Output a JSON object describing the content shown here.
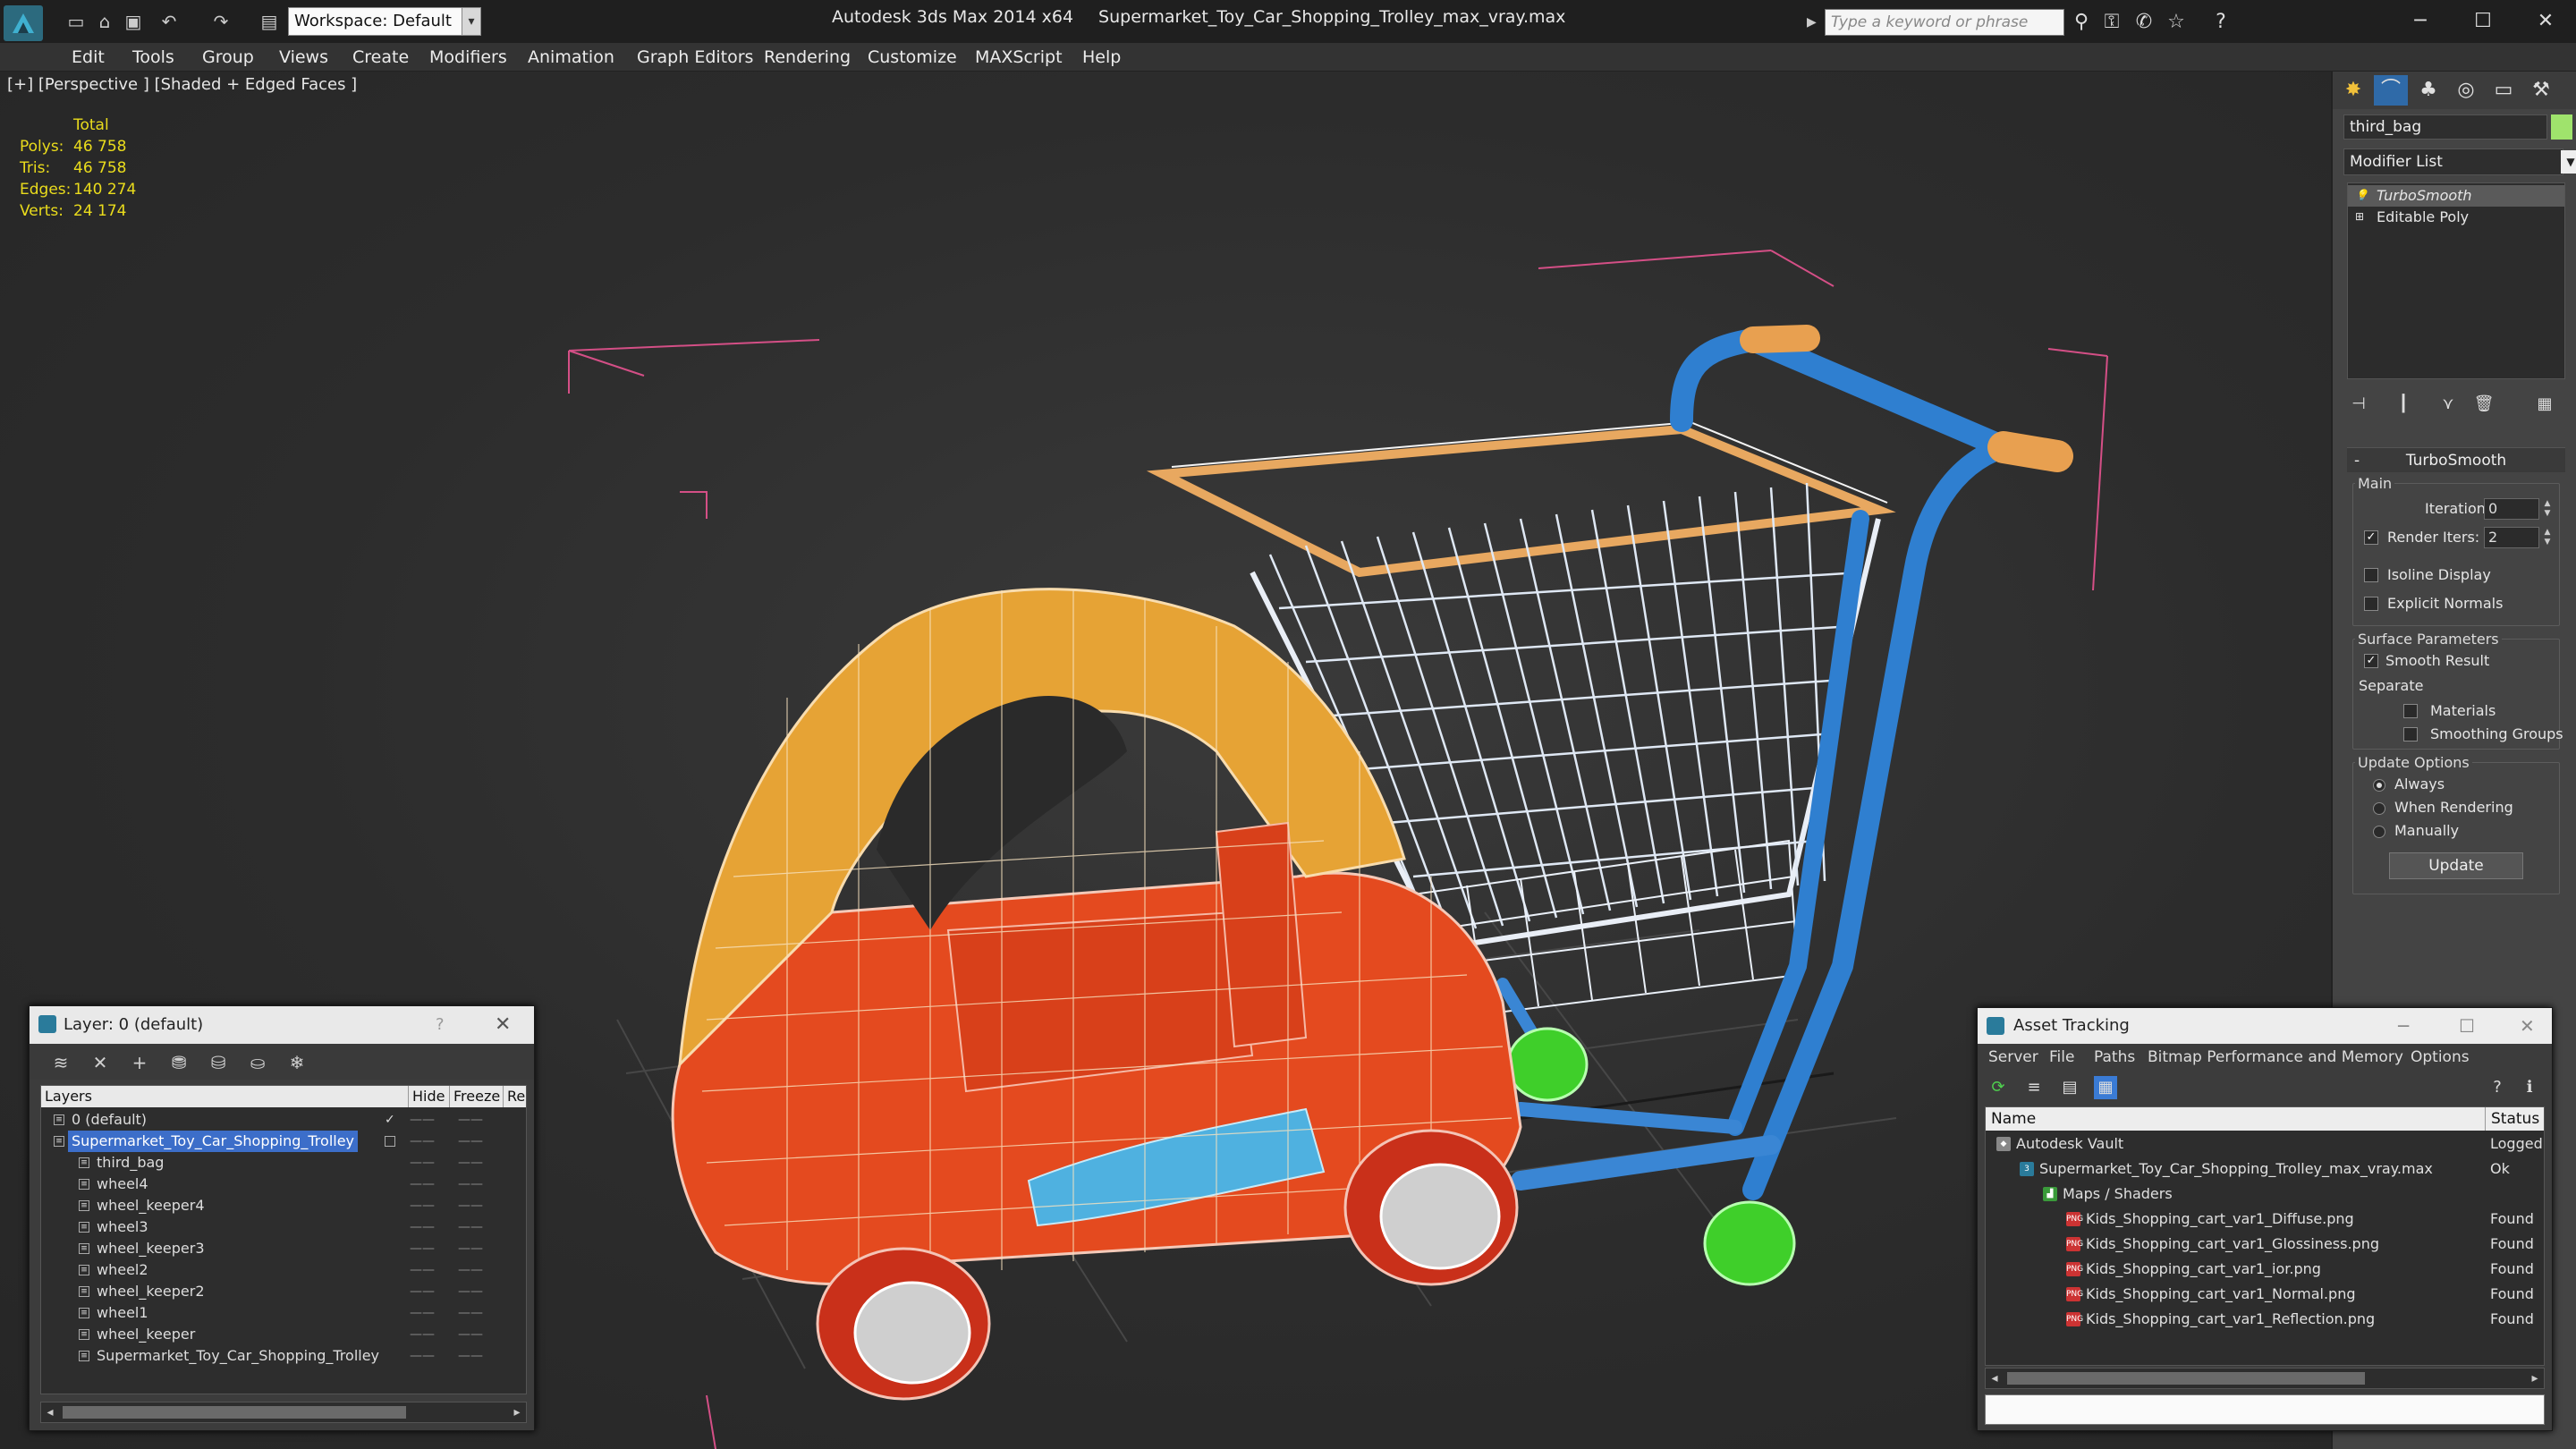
{
  "titlebar": {
    "app_title": "Autodesk 3ds Max  2014 x64",
    "file_title": "Supermarket_Toy_Car_Shopping_Trolley_max_vray.max",
    "workspace": "Workspace: Default",
    "search_placeholder": "Type a keyword or phrase"
  },
  "menu": [
    "Edit",
    "Tools",
    "Group",
    "Views",
    "Create",
    "Modifiers",
    "Animation",
    "Graph Editors",
    "Rendering",
    "Customize",
    "MAXScript",
    "Help"
  ],
  "viewport": {
    "label": "[+] [Perspective ] [Shaded + Edged Faces ]",
    "stats": {
      "header": "Total",
      "rows": [
        {
          "k": "Polys:",
          "v": "46 758"
        },
        {
          "k": "Tris:",
          "v": "46 758"
        },
        {
          "k": "Edges:",
          "v": "140 274"
        },
        {
          "k": "Verts:",
          "v": "24 174"
        }
      ]
    }
  },
  "command_panel": {
    "object_name": "third_bag",
    "object_color": "#9fe36c",
    "modifier_list": "Modifier List",
    "stack": [
      "TurboSmooth",
      "Editable Poly"
    ],
    "rollout_title": "TurboSmooth",
    "main": {
      "label": "Main",
      "iterations_label": "Iterations:",
      "iterations": "0",
      "render_iters_label": "Render Iters:",
      "render_iters": "2",
      "render_iters_checked": true,
      "isoline": "Isoline Display",
      "explicit": "Explicit Normals"
    },
    "surface": {
      "label": "Surface Parameters",
      "smooth_result": "Smooth Result",
      "smooth_checked": true,
      "separate": "Separate",
      "materials": "Materials",
      "smoothing_groups": "Smoothing Groups"
    },
    "update": {
      "label": "Update Options",
      "always": "Always",
      "when_rendering": "When Rendering",
      "manually": "Manually",
      "button": "Update"
    }
  },
  "layer_window": {
    "title": "Layer: 0 (default)",
    "help": "?",
    "columns": [
      "Layers",
      "Hide",
      "Freeze",
      "Re"
    ],
    "rows": [
      {
        "name": "0 (default)",
        "indent": 1,
        "sel": false,
        "current": true
      },
      {
        "name": "Supermarket_Toy_Car_Shopping_Trolley",
        "indent": 1,
        "sel": true,
        "current": false
      },
      {
        "name": "third_bag",
        "indent": 2,
        "sel": false
      },
      {
        "name": "wheel4",
        "indent": 2,
        "sel": false
      },
      {
        "name": "wheel_keeper4",
        "indent": 2,
        "sel": false
      },
      {
        "name": "wheel3",
        "indent": 2,
        "sel": false
      },
      {
        "name": "wheel_keeper3",
        "indent": 2,
        "sel": false
      },
      {
        "name": "wheel2",
        "indent": 2,
        "sel": false
      },
      {
        "name": "wheel_keeper2",
        "indent": 2,
        "sel": false
      },
      {
        "name": "wheel1",
        "indent": 2,
        "sel": false
      },
      {
        "name": "wheel_keeper",
        "indent": 2,
        "sel": false
      },
      {
        "name": "Supermarket_Toy_Car_Shopping_Trolley",
        "indent": 2,
        "sel": false
      }
    ]
  },
  "asset_window": {
    "title": "Asset Tracking",
    "menu": [
      "Server",
      "File",
      "Paths",
      "Bitmap Performance and Memory",
      "Options"
    ],
    "columns": [
      "Name",
      "Status"
    ],
    "rows": [
      {
        "name": "Autodesk Vault",
        "status": "Logged",
        "indent": 0,
        "icon": "vault"
      },
      {
        "name": "Supermarket_Toy_Car_Shopping_Trolley_max_vray.max",
        "status": "Ok",
        "indent": 1,
        "icon": "max"
      },
      {
        "name": "Maps / Shaders",
        "status": "",
        "indent": 2,
        "icon": "maps"
      },
      {
        "name": "Kids_Shopping_cart_var1_Diffuse.png",
        "status": "Found",
        "indent": 3,
        "icon": "png"
      },
      {
        "name": "Kids_Shopping_cart_var1_Glossiness.png",
        "status": "Found",
        "indent": 3,
        "icon": "png"
      },
      {
        "name": "Kids_Shopping_cart_var1_ior.png",
        "status": "Found",
        "indent": 3,
        "icon": "png"
      },
      {
        "name": "Kids_Shopping_cart_var1_Normal.png",
        "status": "Found",
        "indent": 3,
        "icon": "png"
      },
      {
        "name": "Kids_Shopping_cart_var1_Reflection.png",
        "status": "Found",
        "indent": 3,
        "icon": "png"
      }
    ]
  }
}
